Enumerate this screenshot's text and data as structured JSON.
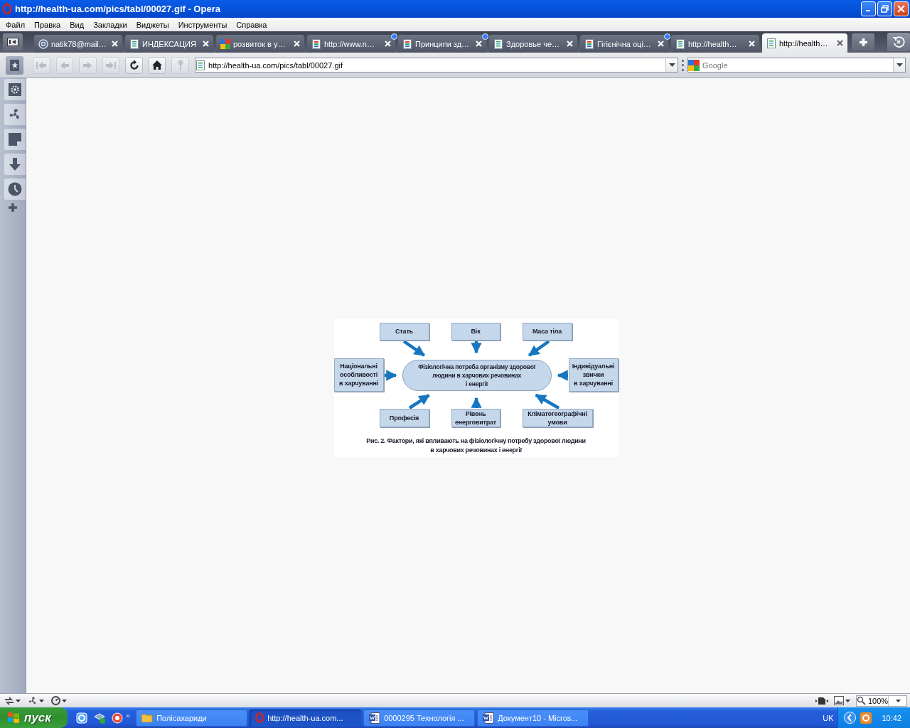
{
  "window": {
    "title": "http://health-ua.com/pics/tabl/00027.gif - Opera"
  },
  "menu": [
    "Файл",
    "Правка",
    "Вид",
    "Закладки",
    "Виджеты",
    "Инструменты",
    "Справка"
  ],
  "tabs": [
    {
      "label": "natik78@mail…",
      "kind": "mail",
      "selected": false,
      "notified": false
    },
    {
      "label": "ИНДЕКСАЦИЯ",
      "kind": "page",
      "selected": false,
      "notified": false
    },
    {
      "label": "розвиток в у…",
      "kind": "google",
      "selected": false,
      "notified": false
    },
    {
      "label": "http://www.n…",
      "kind": "colored",
      "selected": false,
      "notified": true
    },
    {
      "label": "Принципи зд…",
      "kind": "colored",
      "selected": false,
      "notified": true
    },
    {
      "label": "Здоровье че…",
      "kind": "page",
      "selected": false,
      "notified": false
    },
    {
      "label": "Гігієнічна оці…",
      "kind": "colored",
      "selected": false,
      "notified": true
    },
    {
      "label": "http://health…",
      "kind": "page",
      "selected": false,
      "notified": false
    },
    {
      "label": "http://health…",
      "kind": "page",
      "selected": true,
      "notified": false
    }
  ],
  "toolbar": {
    "address": "http://health-ua.com/pics/tabl/00027.gif",
    "search_placeholder": "Google"
  },
  "figure": {
    "center": "Фізіологічна потреба організму здорової\nлюдини в харчових речовинах\nі енергії",
    "factors": [
      "Стать",
      "Вік",
      "Маса тіла",
      "Національні\nособливості\nв харчуванні",
      "Індивідуальні\nзвички\nв харчуванні",
      "Професія",
      "Рівень\nенерговитрат",
      "Кліматогеографічні\nумови"
    ],
    "caption": "Рис. 2. Фактори, які впливають на фізіологічну потребу здорової людини\nв харчових речовинах і енергії"
  },
  "status_bar": {
    "zoom": "100%"
  },
  "taskbar": {
    "start": "пуск",
    "more": "»",
    "tasks": [
      {
        "label": "Полісахариди",
        "kind": "folder",
        "selected": false
      },
      {
        "label": "http://health-ua.com...",
        "kind": "opera",
        "selected": true
      },
      {
        "label": "0000295 Технологія ...",
        "kind": "word",
        "selected": false
      },
      {
        "label": "Документ10 - Micros...",
        "kind": "word",
        "selected": false
      }
    ],
    "language": "UK",
    "clock": "10:42"
  }
}
